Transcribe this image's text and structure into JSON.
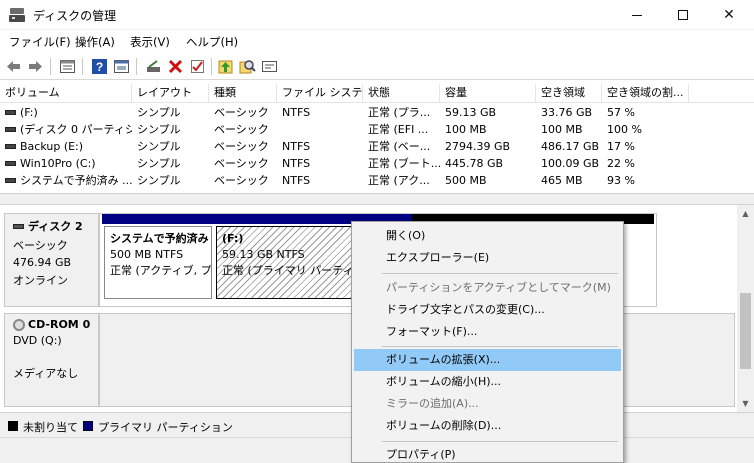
{
  "window": {
    "title": "ディスクの管理",
    "controls": {
      "minimize": "—",
      "maximize": "□",
      "close": "✕"
    }
  },
  "menubar": [
    {
      "id": "file",
      "label": "ファイル(F)"
    },
    {
      "id": "action",
      "label": "操作(A)"
    },
    {
      "id": "view",
      "label": "表示(V)"
    },
    {
      "id": "help",
      "label": "ヘルプ(H)"
    }
  ],
  "toolbar": [
    "back-icon",
    "forward-icon",
    "disk-list-icon",
    "help-icon",
    "console-icon",
    "connect-icon",
    "delete-icon",
    "checkmark-icon",
    "arrow-up-icon",
    "search-icon",
    "properties-icon"
  ],
  "table": {
    "headers": [
      "ボリューム",
      "レイアウト",
      "種類",
      "ファイル システム",
      "状態",
      "容量",
      "空き領域",
      "空き領域の割..."
    ],
    "rows": [
      [
        "(F:)",
        "シンプル",
        "ベーシック",
        "NTFS",
        "正常 (プラ...",
        "59.13 GB",
        "33.76 GB",
        "57 %"
      ],
      [
        "(ディスク 0 パーティシ...",
        "シンプル",
        "ベーシック",
        "",
        "正常 (EFI ...",
        "100 MB",
        "100 MB",
        "100 %"
      ],
      [
        "Backup (E:)",
        "シンプル",
        "ベーシック",
        "NTFS",
        "正常 (ベー...",
        "2794.39 GB",
        "486.17 GB",
        "17 %"
      ],
      [
        "Win10Pro (C:)",
        "シンプル",
        "ベーシック",
        "NTFS",
        "正常 (ブート...",
        "445.78 GB",
        "100.09 GB",
        "22 %"
      ],
      [
        "システムで予約済み ...",
        "シンプル",
        "ベーシック",
        "NTFS",
        "正常 (アク...",
        "500 MB",
        "465 MB",
        "93 %"
      ]
    ]
  },
  "disks": [
    {
      "title": "ディスク 2",
      "type": "ベーシック",
      "size": "476.94 GB",
      "status": "オンライン",
      "partitions": [
        {
          "name": "システムで予約済み",
          "line2": "500 MB NTFS",
          "line3": "正常 (アクティブ, プラ"
        },
        {
          "name": "(F:)",
          "line2": "59.13 GB NTFS",
          "line3": "正常 (プライマリ パーティシ"
        }
      ]
    },
    {
      "title": "CD-ROM 0",
      "type": "DVD (Q:)",
      "media": "メディアなし"
    }
  ],
  "legend": [
    {
      "label": "未割り当て",
      "color": "#000000"
    },
    {
      "label": "プライマリ パーティション",
      "color": "#000080"
    }
  ],
  "context_menu": [
    {
      "label": "開く(O)"
    },
    {
      "label": "エクスプローラー(E)"
    },
    {
      "sep": true
    },
    {
      "label": "パーティションをアクティブとしてマーク(M)",
      "disabled": true
    },
    {
      "label": "ドライブ文字とパスの変更(C)..."
    },
    {
      "label": "フォーマット(F)..."
    },
    {
      "sep": true
    },
    {
      "label": "ボリュームの拡張(X)...",
      "highlighted": true
    },
    {
      "label": "ボリュームの縮小(H)..."
    },
    {
      "label": "ミラーの追加(A)...",
      "disabled": true
    },
    {
      "label": "ボリュームの削除(D)..."
    },
    {
      "sep": true
    },
    {
      "label": "プロパティ(P)"
    }
  ],
  "colors": {
    "primary_partition": "#000080",
    "unallocated": "#000000",
    "highlight": "#91c9f7"
  }
}
